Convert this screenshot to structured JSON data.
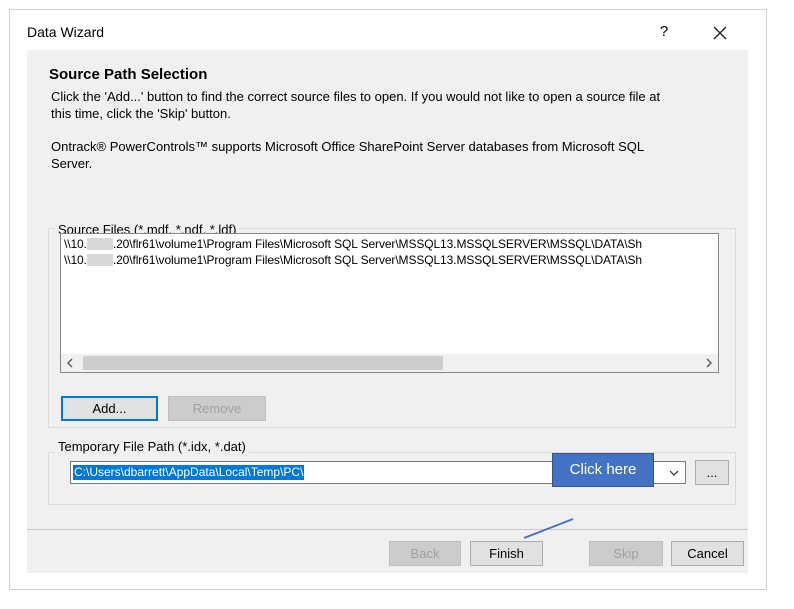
{
  "window": {
    "title": "Data Wizard",
    "help": "?",
    "close": "✕"
  },
  "page": {
    "heading": "Source Path Selection",
    "desc1_line1": "Click the 'Add...' button to find the correct source files to open.  If you would not like to open a source file at",
    "desc1_line2": "this time, click the 'Skip' button.",
    "desc2_line1": "Ontrack® PowerControls™ supports Microsoft Office SharePoint Server databases from Microsoft SQL",
    "desc2_line2": "Server."
  },
  "source_files": {
    "label": "Source Files (*.mdf, *.ndf, *.ldf)",
    "items": [
      {
        "prefix": "\\\\10.",
        "suffix": ".20\\flr61\\volume1\\Program Files\\Microsoft SQL Server\\MSSQL13.MSSQLSERVER\\MSSQL\\DATA\\Sh"
      },
      {
        "prefix": "\\\\10.",
        "suffix": ".20\\flr61\\volume1\\Program Files\\Microsoft SQL Server\\MSSQL13.MSSQLSERVER\\MSSQL\\DATA\\Sh"
      }
    ],
    "add_label": "Add...",
    "remove_label": "Remove"
  },
  "temp_path": {
    "label": "Temporary File Path (*.idx, *.dat)",
    "value": "C:\\Users\\dbarrett\\AppData\\Local\\Temp\\PC\\",
    "browse_label": "..."
  },
  "footer": {
    "back_label": "Back",
    "finish_label": "Finish",
    "skip_label": "Skip",
    "cancel_label": "Cancel"
  },
  "callout": {
    "text": "Click here"
  },
  "colors": {
    "accent": "#0078d7",
    "callout": "#4472c4"
  }
}
